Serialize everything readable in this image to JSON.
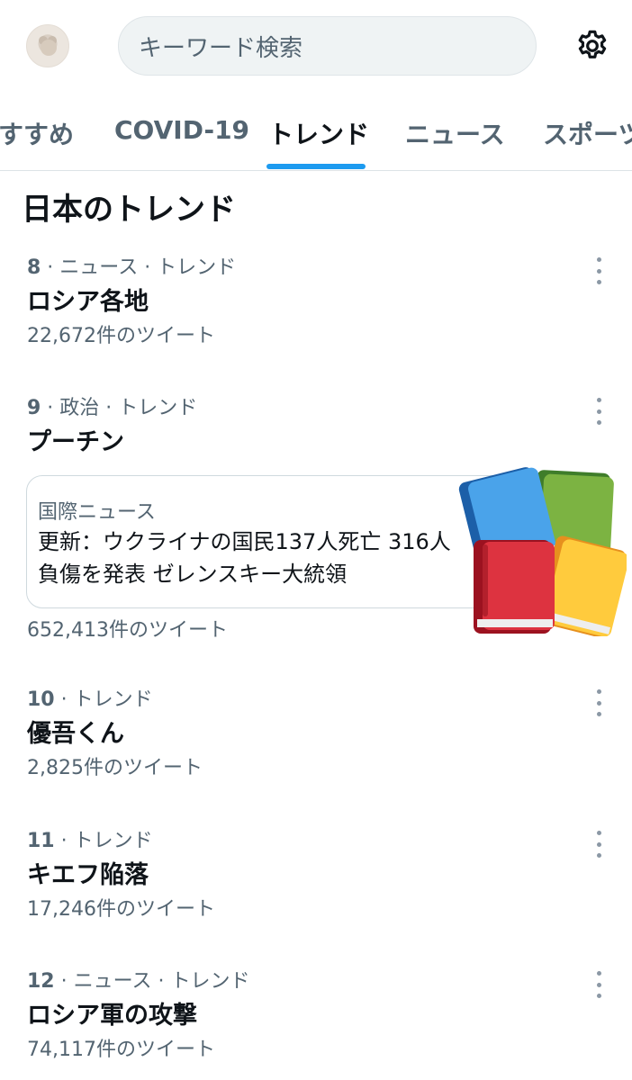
{
  "search": {
    "placeholder": "キーワード検索"
  },
  "tabs": [
    {
      "label": "すすめ"
    },
    {
      "label": "COVID-19"
    },
    {
      "label": "トレンド"
    },
    {
      "label": "ニュース"
    },
    {
      "label": "スポーツ"
    }
  ],
  "section": {
    "title": "日本のトレンド"
  },
  "trends": [
    {
      "rank": "8",
      "category": "ニュース · トレンド",
      "name": "ロシア各地",
      "count": "22,672件のツイート"
    },
    {
      "rank": "9",
      "category": "政治 · トレンド",
      "name": "プーチン"
    },
    {
      "rank": "10",
      "category": "トレンド",
      "name": "優吾くん",
      "count": "2,825件のツイート"
    },
    {
      "rank": "11",
      "category": "トレンド",
      "name": "キエフ陥落",
      "count": "17,246件のツイート"
    },
    {
      "rank": "12",
      "category": "ニュース · トレンド",
      "name": "ロシア軍の攻撃",
      "count": "74,117件のツイート"
    }
  ],
  "news_card": {
    "source": "国際ニュース",
    "title": "更新：ウクライナの国民137人死亡 316人負傷を発表 ゼレンスキー大統領",
    "count": "652,413件のツイート"
  },
  "colors": {
    "accent": "#1d9bf0",
    "secondary_text": "#536471"
  },
  "icons": {
    "settings": "gear-icon",
    "more": "more-icon",
    "news_thumbnail": "books-icon"
  }
}
